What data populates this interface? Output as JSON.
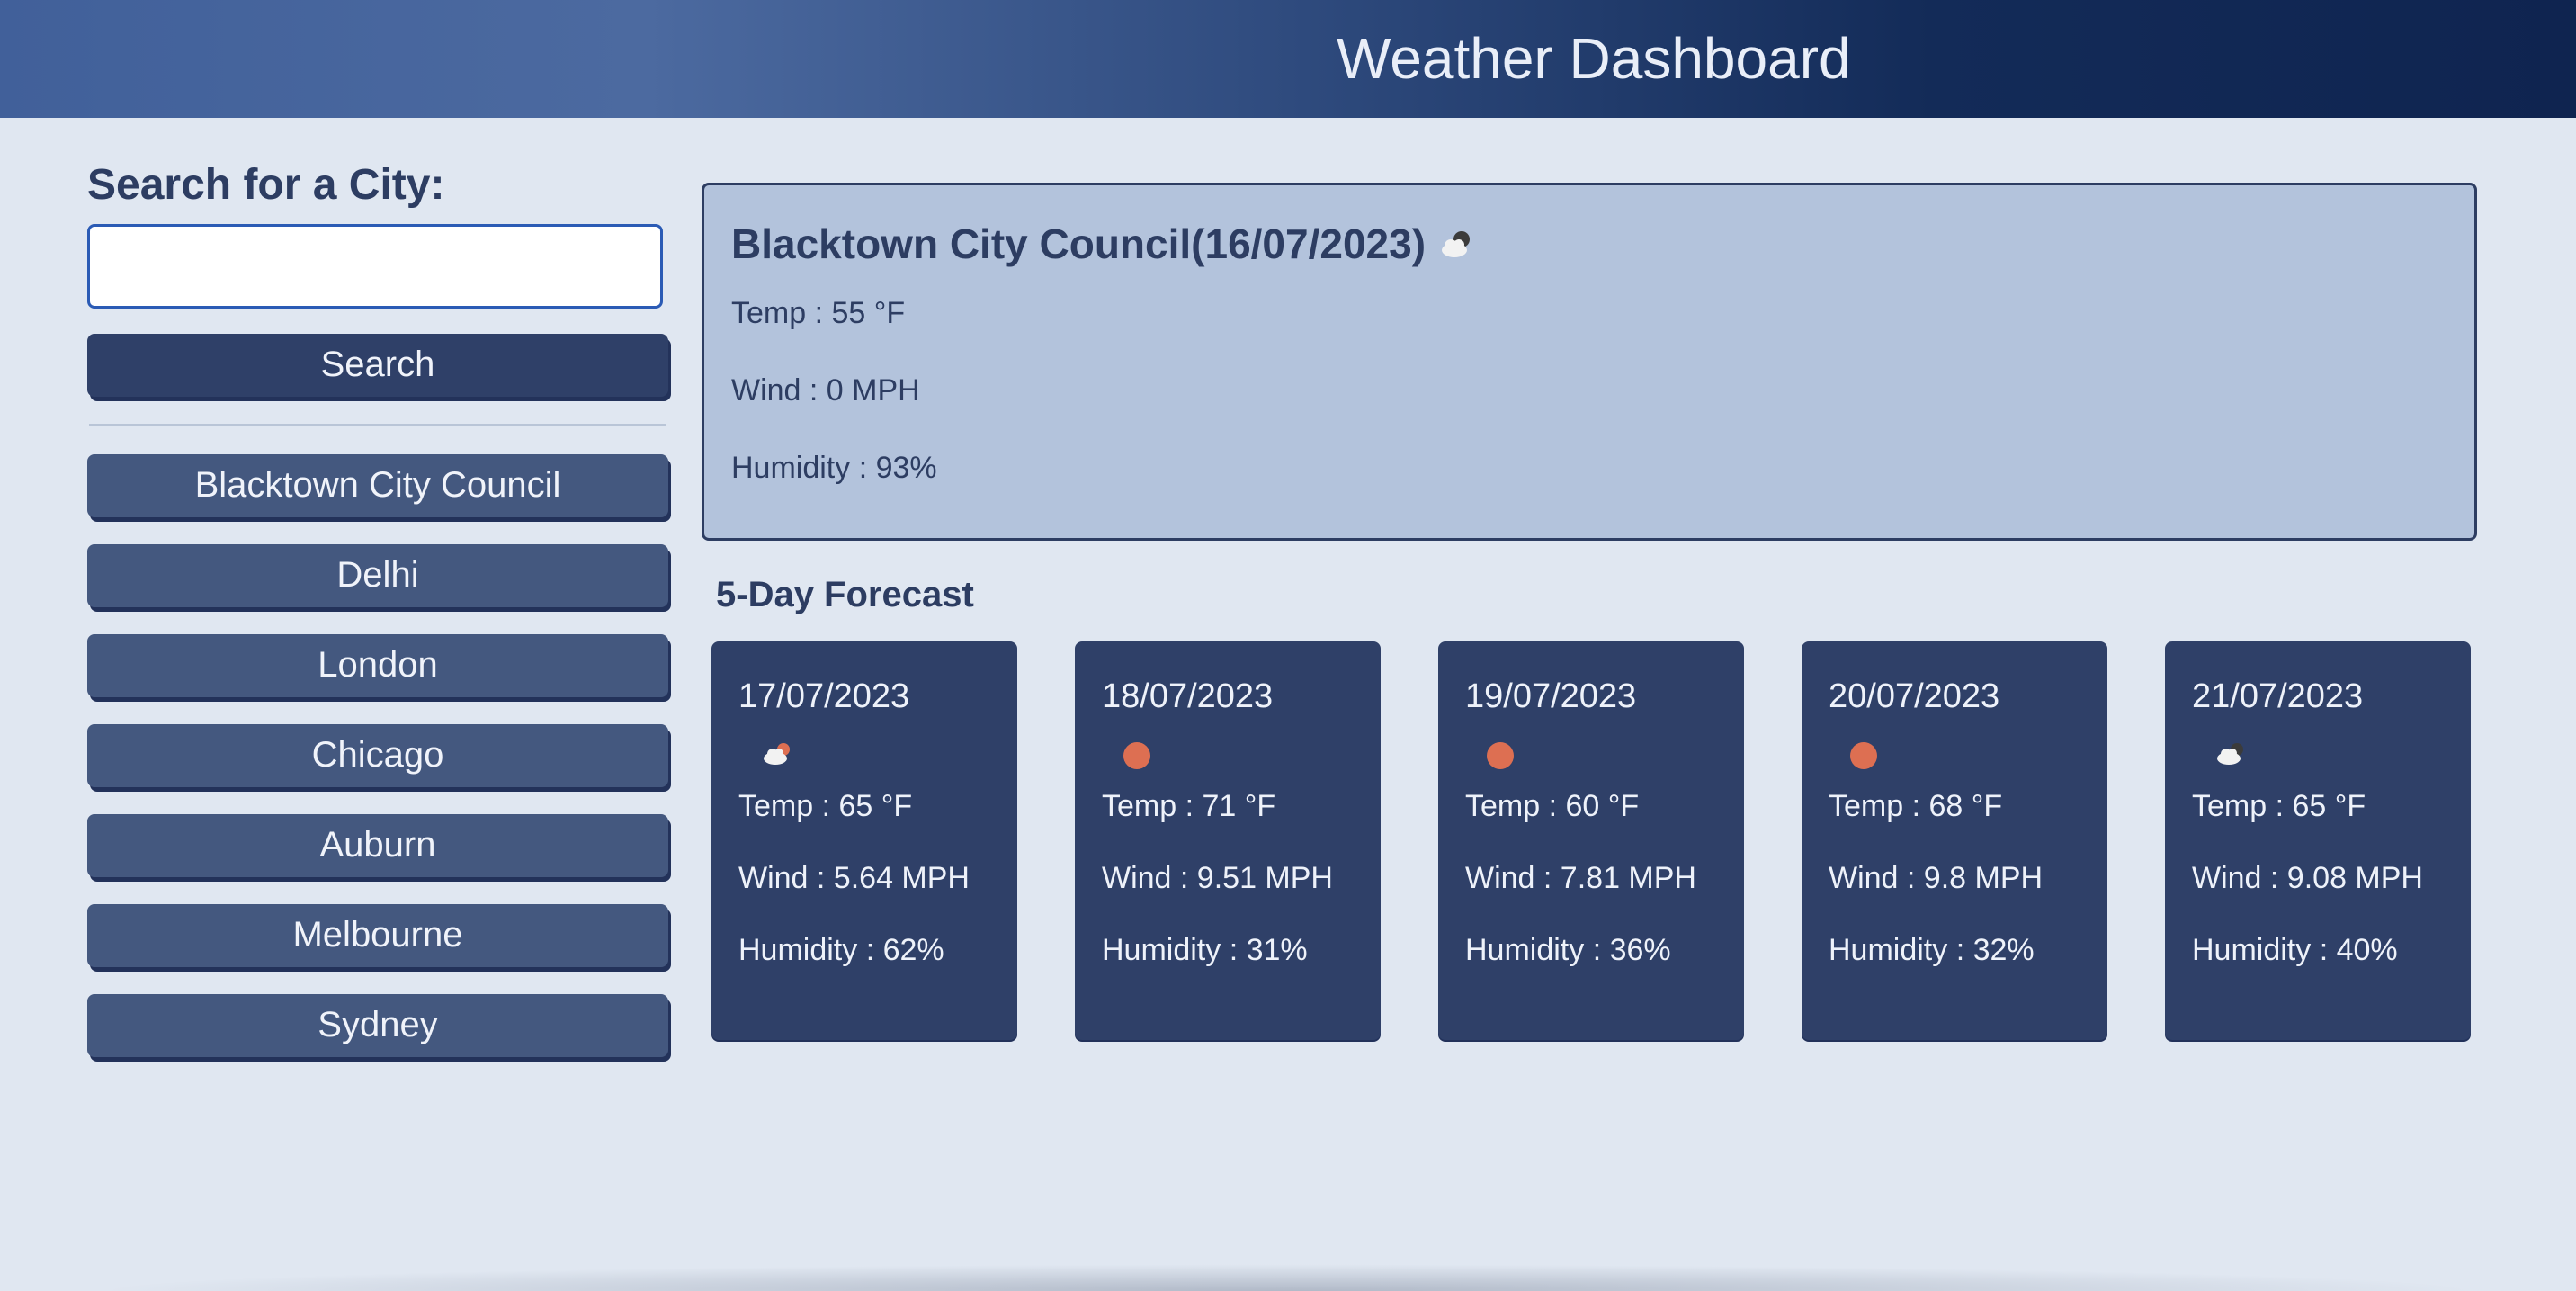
{
  "header": {
    "title": "Weather Dashboard"
  },
  "search": {
    "label": "Search for a City:",
    "value": "",
    "placeholder": "",
    "button_label": "Search"
  },
  "history": {
    "cities": [
      "Blacktown City Council",
      "Delhi",
      "London",
      "Chicago",
      "Auburn",
      "Melbourne",
      "Sydney"
    ]
  },
  "current": {
    "city": "Blacktown City Council",
    "date": "(16/07/2023)",
    "icon": "cloud-night-icon",
    "temp": "Temp : 55 °F",
    "wind": "Wind : 0 MPH",
    "humidity": "Humidity : 93%"
  },
  "forecast": {
    "heading": "5-Day Forecast",
    "days": [
      {
        "date": "17/07/2023",
        "icon": "cloud-sun-icon",
        "temp": "Temp : 65 °F",
        "wind": "Wind : 5.64 MPH",
        "humidity": "Humidity : 62%"
      },
      {
        "date": "18/07/2023",
        "icon": "sun-icon",
        "temp": "Temp : 71 °F",
        "wind": "Wind : 9.51 MPH",
        "humidity": "Humidity : 31%"
      },
      {
        "date": "19/07/2023",
        "icon": "sun-icon",
        "temp": "Temp : 60 °F",
        "wind": "Wind : 7.81 MPH",
        "humidity": "Humidity : 36%"
      },
      {
        "date": "20/07/2023",
        "icon": "sun-icon",
        "temp": "Temp : 68 °F",
        "wind": "Wind : 9.8 MPH",
        "humidity": "Humidity : 32%"
      },
      {
        "date": "21/07/2023",
        "icon": "cloud-icon",
        "temp": "Temp : 65 °F",
        "wind": "Wind : 9.08 MPH",
        "humidity": "Humidity : 40%"
      }
    ]
  },
  "colors": {
    "page_bg": "#e0e7f1",
    "primary": "#2f4068",
    "history_button": "#44587f",
    "current_panel": "#b3c3dc",
    "sun": "#dd6f52"
  }
}
